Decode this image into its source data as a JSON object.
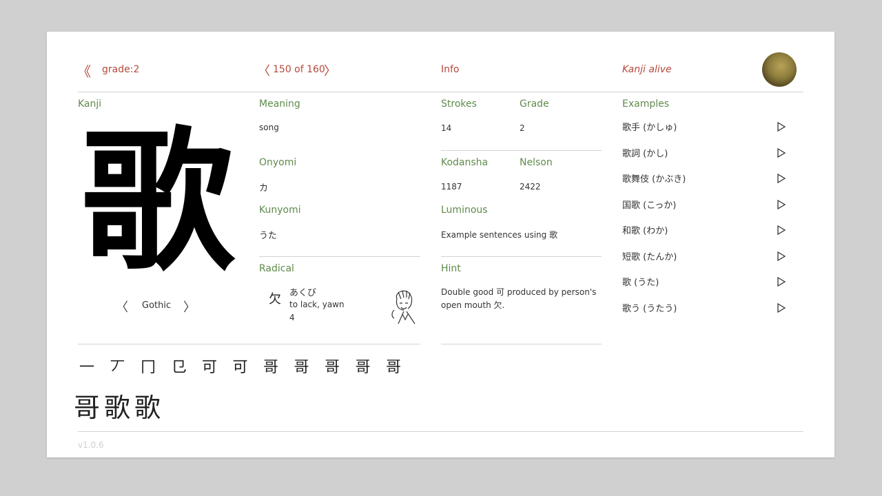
{
  "header": {
    "back_icon": "double-chevron-left-icon",
    "grade_label": "grade:2",
    "position_label": "150 of 160",
    "info_label": "Info",
    "app_name": "Kanji alive"
  },
  "kanji": {
    "section_label": "Kanji",
    "character": "歌",
    "font_label": "Gothic"
  },
  "meaning": {
    "label": "Meaning",
    "value": "song"
  },
  "onyomi": {
    "label": "Onyomi",
    "value": "カ"
  },
  "kunyomi": {
    "label": "Kunyomi",
    "value": "うた"
  },
  "radical": {
    "label": "Radical",
    "character": "欠",
    "reading": "あくび",
    "meaning": "to lack, yawn",
    "strokes": "4"
  },
  "info": {
    "strokes_label": "Strokes",
    "strokes_value": "14",
    "grade_label": "Grade",
    "grade_value": "2",
    "kodansha_label": "Kodansha",
    "kodansha_value": "1187",
    "nelson_label": "Nelson",
    "nelson_value": "2422",
    "luminous_label": "Luminous",
    "luminous_link": "Example sentences using 歌",
    "hint_label": "Hint",
    "hint_text": "Double good 可 produced by person's open mouth 欠."
  },
  "examples": {
    "label": "Examples",
    "items": [
      "歌手 (かしゅ)",
      "歌詞 (かし)",
      "歌舞伎 (かぶき)",
      "国歌 (こっか)",
      "和歌 (わか)",
      "短歌 (たんか)",
      "歌 (うた)",
      "歌う (うたう)"
    ]
  },
  "stroke_order": {
    "steps": [
      "一",
      "丆",
      "冂",
      "㔾",
      "可",
      "可",
      "哥",
      "哥",
      "哥",
      "哥",
      "哥",
      "哥",
      "歌",
      "歌"
    ]
  },
  "footer": {
    "version": "v1.0.6"
  },
  "colors": {
    "accent": "#b5483a",
    "label": "#5f8a4b",
    "card": "#ffffff",
    "backdrop": "#d0d0d0"
  }
}
